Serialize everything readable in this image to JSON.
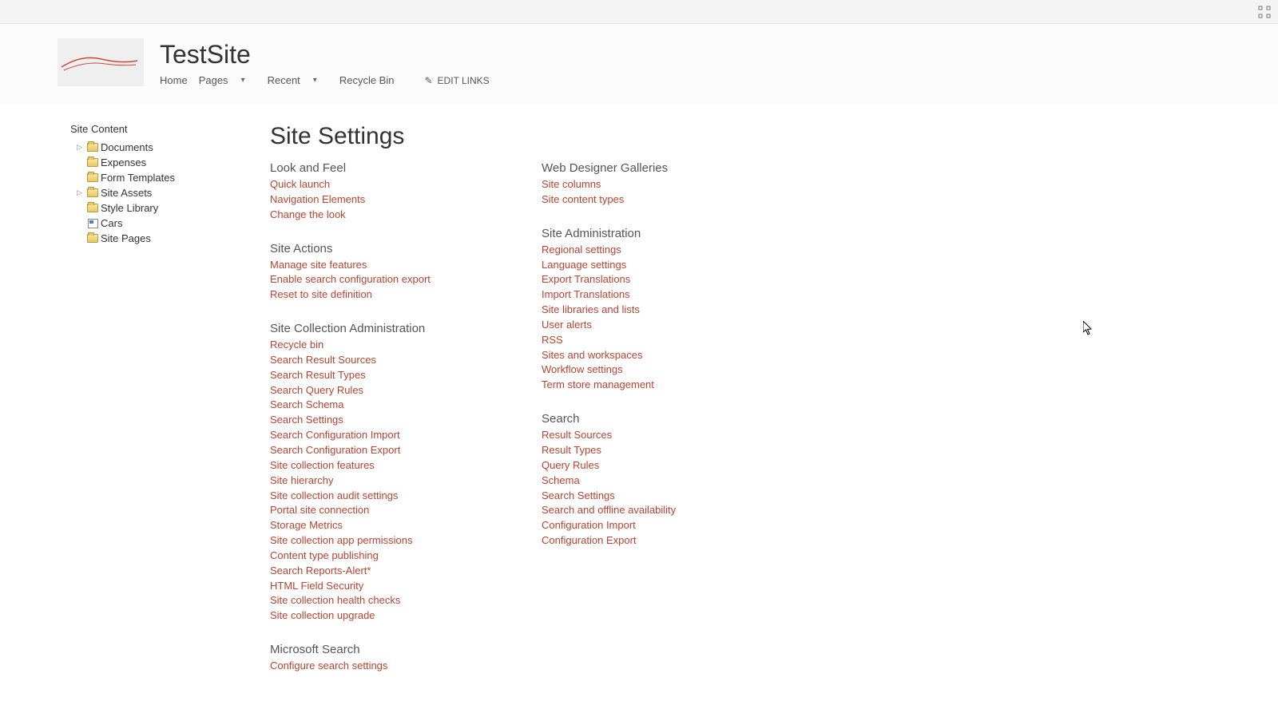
{
  "header": {
    "site_title": "TestSite",
    "nav": {
      "home": "Home",
      "pages": "Pages",
      "recent": "Recent",
      "recycle_bin": "Recycle Bin",
      "edit_links": "EDIT LINKS"
    }
  },
  "sidebar": {
    "heading": "Site Content",
    "items": [
      {
        "label": "Documents",
        "expandable": true,
        "type": "folder"
      },
      {
        "label": "Expenses",
        "expandable": false,
        "type": "folder"
      },
      {
        "label": "Form Templates",
        "expandable": false,
        "type": "folder"
      },
      {
        "label": "Site Assets",
        "expandable": true,
        "type": "folder"
      },
      {
        "label": "Style Library",
        "expandable": false,
        "type": "folder"
      },
      {
        "label": "Cars",
        "expandable": false,
        "type": "list"
      },
      {
        "label": "Site Pages",
        "expandable": false,
        "type": "folder"
      }
    ]
  },
  "main": {
    "page_title": "Site Settings",
    "left_column": [
      {
        "title": "Look and Feel",
        "links": [
          "Quick launch",
          "Navigation Elements",
          "Change the look"
        ]
      },
      {
        "title": "Site Actions",
        "links": [
          "Manage site features",
          "Enable search configuration export",
          "Reset to site definition"
        ]
      },
      {
        "title": "Site Collection Administration",
        "links": [
          "Recycle bin",
          "Search Result Sources",
          "Search Result Types",
          "Search Query Rules",
          "Search Schema",
          "Search Settings",
          "Search Configuration Import",
          "Search Configuration Export",
          "Site collection features",
          "Site hierarchy",
          "Site collection audit settings",
          "Portal site connection",
          "Storage Metrics",
          "Site collection app permissions",
          "Content type publishing",
          "Search Reports-Alert*",
          "HTML Field Security",
          "Site collection health checks",
          "Site collection upgrade"
        ]
      },
      {
        "title": "Microsoft Search",
        "links": [
          "Configure search settings"
        ]
      }
    ],
    "right_column": [
      {
        "title": "Web Designer Galleries",
        "links": [
          "Site columns",
          "Site content types"
        ]
      },
      {
        "title": "Site Administration",
        "links": [
          "Regional settings",
          "Language settings",
          "Export Translations",
          "Import Translations",
          "Site libraries and lists",
          "User alerts",
          "RSS",
          "Sites and workspaces",
          "Workflow settings",
          "Term store management"
        ]
      },
      {
        "title": "Search",
        "links": [
          "Result Sources",
          "Result Types",
          "Query Rules",
          "Schema",
          "Search Settings",
          "Search and offline availability",
          "Configuration Import",
          "Configuration Export"
        ]
      }
    ]
  }
}
